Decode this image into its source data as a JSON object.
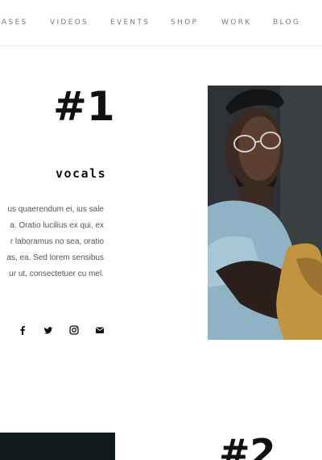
{
  "nav": {
    "items": [
      "ASES",
      "VIDEOS",
      "EVENTS",
      "SHOP",
      "WORK",
      "BLOG"
    ]
  },
  "member1": {
    "number": "#1",
    "role": "vocals",
    "bio_lines": [
      "us quaerendum ei, ius sale",
      "a. Oratio lucilius ex qui, ex",
      "r laboramus no sea, oratio",
      "as, ea. Sed lorem sensibus",
      "ur ut, consectetuer cu mel."
    ],
    "social_icons": [
      "facebook-icon",
      "twitter-icon",
      "instagram-icon",
      "email-icon"
    ]
  },
  "member2": {
    "number": "#2"
  },
  "colors": {
    "text_dark": "#111111",
    "text_muted": "#555555",
    "nav_text": "#7a7a7a",
    "photo_dark": "#0f1a1c"
  }
}
